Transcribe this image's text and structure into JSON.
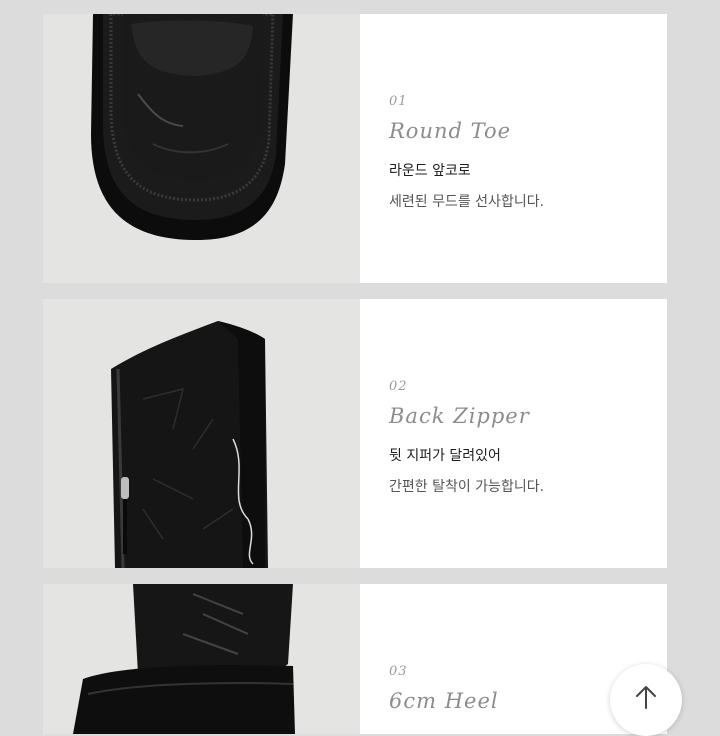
{
  "features": [
    {
      "number": "01",
      "title": "Round Toe",
      "line1": "라운드 앞코로",
      "line2": "세련된 무드를 선사합니다."
    },
    {
      "number": "02",
      "title": "Back Zipper",
      "line1": "뒷 지퍼가 달려있어",
      "line2": "간편한 탈착이 가능합니다."
    },
    {
      "number": "03",
      "title": "6cm Heel",
      "line1": "",
      "line2": ""
    }
  ],
  "scroll_top": {
    "icon": "arrow-up-icon"
  },
  "colors": {
    "page_background": "#dcdcdc",
    "card": "#ffffff",
    "photo_background": "#e4e5e3",
    "boot": "#131313"
  }
}
